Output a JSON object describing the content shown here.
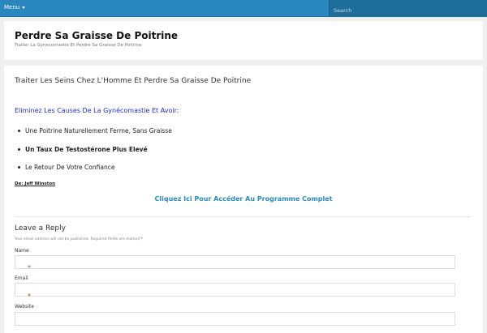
{
  "topbar": {
    "menu_label": "Menu",
    "search_placeholder": "Search"
  },
  "site": {
    "title": "Perdre Sa Graisse De Poitrine",
    "description": "Traiter La Gynecomastie Et Perdre Sa Graisse De Poitrine"
  },
  "article": {
    "title": "Traiter Les Seins Chez L'Homme Et Perdre Sa Graisse De Poitrine",
    "section_heading": "Eliminez Les Causes De La Gynécomastie Et Avoir:",
    "benefits": [
      "Une Poitrine Naturellement Ferme, Sans Graisse",
      "Un Taux De Testostérone Plus Elevé",
      "Le Retour De Votre Confiance"
    ],
    "author": "De: Jeff Winston",
    "cta_link": "Cliquez Ici Pour Accéder Au Programme Complet"
  },
  "comments": {
    "title": "Leave a Reply",
    "note": "Your email address will not be published. Required fields are marked",
    "required_marker": "*",
    "fields": {
      "name_label": "Name",
      "email_label": "Email",
      "website_label": "Website"
    }
  },
  "colors": {
    "topbar": "#2a86be",
    "link": "#2b8ac0",
    "heading_blue": "#1a2fd1",
    "required": "#c0392b"
  }
}
